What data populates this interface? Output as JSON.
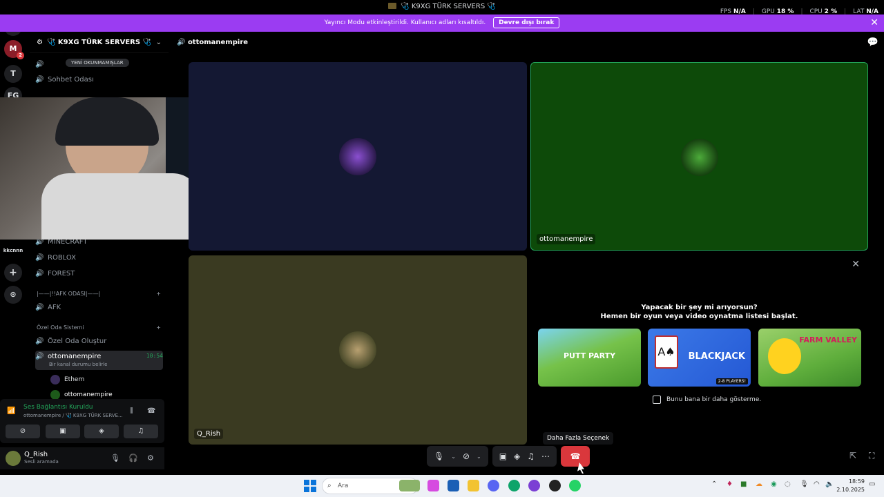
{
  "titlebar": {
    "title": "🩺 K9XG TÜRK SERVERS 🩺",
    "stats": [
      {
        "label": "FPS",
        "value": "N/A"
      },
      {
        "label": "GPU",
        "value": "18 %"
      },
      {
        "label": "CPU",
        "value": "2 %"
      },
      {
        "label": "LAT",
        "value": "N/A"
      }
    ]
  },
  "banner": {
    "text": "Yayıncı Modu etkinleştirildi. Kullanıcı adları kısaltıldı.",
    "button": "Devre dışı bırak",
    "close": "✕"
  },
  "guilds": {
    "items": [
      "T",
      "FG"
    ],
    "badge": "2",
    "small_label": "kkcnnn"
  },
  "server": {
    "name": "🩺 K9XG TÜRK SERVERS 🩺",
    "unread_pill": "YENİ OKUNMAMIŞLAR",
    "channels": {
      "sohbet": "Sohbet Odası",
      "ethem_tag": "Ethem",
      "minecraft": "MINECRAFT",
      "roblox": "ROBLOX",
      "forest": "FOREST",
      "afk_cat": "|——|!!AFK ODASI|——|",
      "afk": "AFK",
      "ozel_cat": "Özel Oda Sistemi",
      "ozel_olustur": "Özel Oda Oluştur",
      "active": "ottomanempire",
      "active_time": "10:54",
      "active_sub": "Bir kanal durumu belirle"
    },
    "members": [
      "Ethem",
      "ottomanempire"
    ]
  },
  "voice_panel": {
    "status": "Ses Bağlantısı Kuruldu",
    "sub": "ottomanempire / 🩺 K9XG TÜRK SERVE..."
  },
  "user": {
    "name": "Q_Rish",
    "status": "Sesli aramada"
  },
  "main": {
    "channel_title": "ottomanempire",
    "tiles": {
      "green_label": "ottomanempire",
      "olive_label": "Q_Rish"
    }
  },
  "activity": {
    "close": "✕",
    "line1": "Yapacak bir şey mi arıyorsun?",
    "line2": "Hemen bir oyun veya video oynatma listesi başlat.",
    "games": [
      {
        "name": "PUTT PARTY"
      },
      {
        "name": "BLACKJACK",
        "players": "2-8 PLAYERS!"
      },
      {
        "name": "FARM VALLEY"
      }
    ],
    "checkbox": "Bunu bana bir daha gösterme."
  },
  "tooltip": "Daha Fazla Seçenek",
  "taskbar": {
    "search": "Ara",
    "time": "18:59",
    "date": "2.10.2025"
  },
  "colors": {
    "banner": "#9b3cf2",
    "tile_green": "#0d4a09",
    "tile_navy": "#141833",
    "tile_olive": "#3a3a21",
    "leave": "#da373c",
    "connected": "#23a55a"
  }
}
